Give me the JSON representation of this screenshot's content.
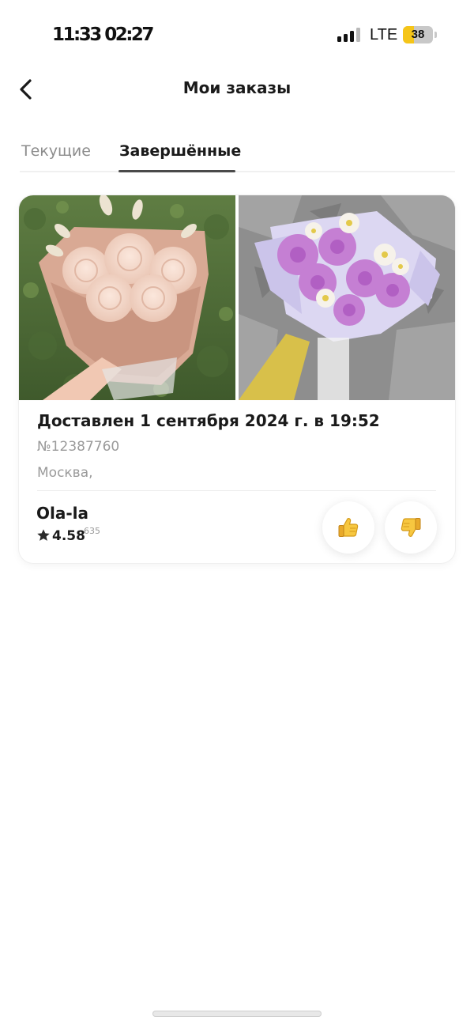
{
  "status_bar": {
    "time": "11:33 02:27",
    "network": "LTE",
    "battery": "38",
    "battery_level": 0.38
  },
  "header": {
    "title": "Мои заказы",
    "back_icon": "chevron-left-icon"
  },
  "tabs": [
    {
      "label": "Текущие",
      "active": false
    },
    {
      "label": "Завершённые",
      "active": true
    }
  ],
  "order": {
    "status": "Доставлен 1 сентября 2024 г. в 19:52",
    "number": "№12387760",
    "address": "Москва, ",
    "shop": {
      "name": "Ola-la",
      "rating": "4.58",
      "reviews": "635"
    },
    "like_icon": "thumbs-up-icon",
    "dislike_icon": "thumbs-down-icon",
    "photo_1": "bouquet-peach-roses-photo",
    "photo_2": "bouquet-purple-chrysanthemums-photo"
  },
  "colors": {
    "accent_yellow": "#f5c518",
    "text_primary": "#1a1a1a",
    "text_secondary": "#9a9a9a"
  }
}
